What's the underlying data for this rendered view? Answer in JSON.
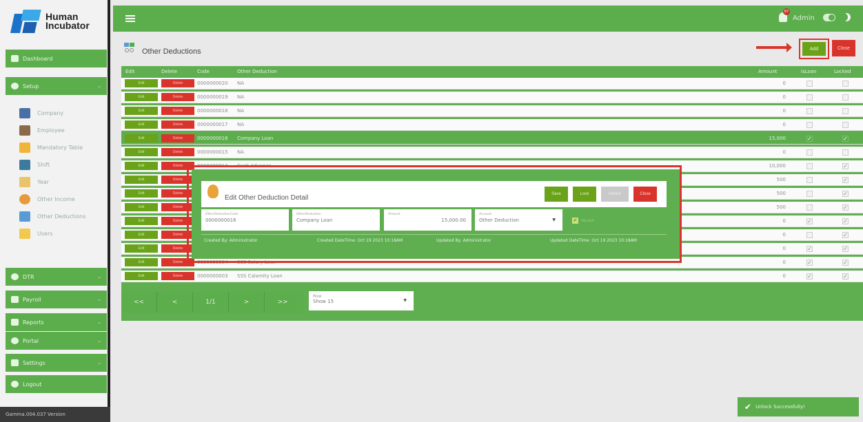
{
  "app": {
    "logo_line1": "Human",
    "logo_line2": "Incubator",
    "version": "Gamma.004.037 Version"
  },
  "topbar": {
    "user": "Admin",
    "notification_count": "87"
  },
  "sidebar": {
    "dashboard": "Dashboard",
    "setup": "Setup",
    "setup_items": [
      "Company",
      "Employee",
      "Mandatory Table",
      "Shift",
      "Year",
      "Other Income",
      "Other Deductions",
      "Users"
    ],
    "dtr": "DTR",
    "payroll": "Payroll",
    "reports": "Reports",
    "portal": "Portal",
    "settings": "Settings",
    "logout": "Logout"
  },
  "page": {
    "title": "Other Deductions",
    "add_label": "Add",
    "close_label": "Close"
  },
  "table": {
    "headers": {
      "edit": "Edit",
      "delete": "Delete",
      "code": "Code",
      "deduction": "Other Deduction",
      "amount": "Amount",
      "isloan": "IsLoan",
      "locked": "Locked"
    },
    "edit_label": "Edit",
    "delete_label": "Delete",
    "rows": [
      {
        "code": "0000000020",
        "name": "NA",
        "amount": "0",
        "isloan": false,
        "locked": false
      },
      {
        "code": "0000000019",
        "name": "NA",
        "amount": "0",
        "isloan": false,
        "locked": false
      },
      {
        "code": "0000000018",
        "name": "NA",
        "amount": "0",
        "isloan": false,
        "locked": false
      },
      {
        "code": "0000000017",
        "name": "NA",
        "amount": "0",
        "isloan": false,
        "locked": false
      },
      {
        "code": "0000000016",
        "name": "Company Loan",
        "amount": "15,000",
        "isloan": true,
        "locked": true,
        "selected": true
      },
      {
        "code": "0000000015",
        "name": "NA",
        "amount": "0",
        "isloan": false,
        "locked": false
      },
      {
        "code": "0000000014",
        "name": "Cash Advance",
        "amount": "10,000",
        "isloan": false,
        "locked": true
      },
      {
        "code": "",
        "name": "",
        "amount": "500",
        "isloan": false,
        "locked": true
      },
      {
        "code": "",
        "name": "",
        "amount": "500",
        "isloan": false,
        "locked": true
      },
      {
        "code": "",
        "name": "",
        "amount": "500",
        "isloan": false,
        "locked": true
      },
      {
        "code": "",
        "name": "",
        "amount": "0",
        "isloan": true,
        "locked": true
      },
      {
        "code": "",
        "name": "",
        "amount": "0",
        "isloan": false,
        "locked": true
      },
      {
        "code": "",
        "name": "",
        "amount": "0",
        "isloan": true,
        "locked": true
      },
      {
        "code": "0000000004",
        "name": "SSS Salary Loan",
        "amount": "0",
        "isloan": true,
        "locked": true
      },
      {
        "code": "0000000003",
        "name": "SSS Calamity Loan",
        "amount": "0",
        "isloan": true,
        "locked": true
      }
    ]
  },
  "pager": {
    "first": "<<",
    "prev": "<",
    "page": "1/1",
    "next": ">",
    "last": ">>",
    "rows_label": "Row",
    "rows_value": "Show 15"
  },
  "modal": {
    "title": "Edit Other Deduction Detail",
    "save": "Save",
    "lock": "Lock",
    "unlock": "Unlock",
    "close": "Close",
    "code_label": "OtherDeductionCode",
    "code_value": "0000000016",
    "deduction_label": "OtherDeduction",
    "deduction_value": "Company Loan",
    "amount_label": "Amount",
    "amount_value": "15,000.00",
    "account_label": "Account",
    "account_value": "Other Deduction",
    "isloan_label": "IsLoan",
    "created_by": "Created By: Administrator",
    "created_time": "Created DateTime: Oct 19 2023 10:18AM",
    "updated_by": "Updated By: Administrator",
    "updated_time": "Updated DateTime: Oct 19 2023 10:18AM"
  },
  "toast": {
    "message": "Unlock Successfully!"
  },
  "colors": {
    "green": "#5cad4c",
    "button_green": "#6aa21a",
    "red": "#d9342b"
  }
}
